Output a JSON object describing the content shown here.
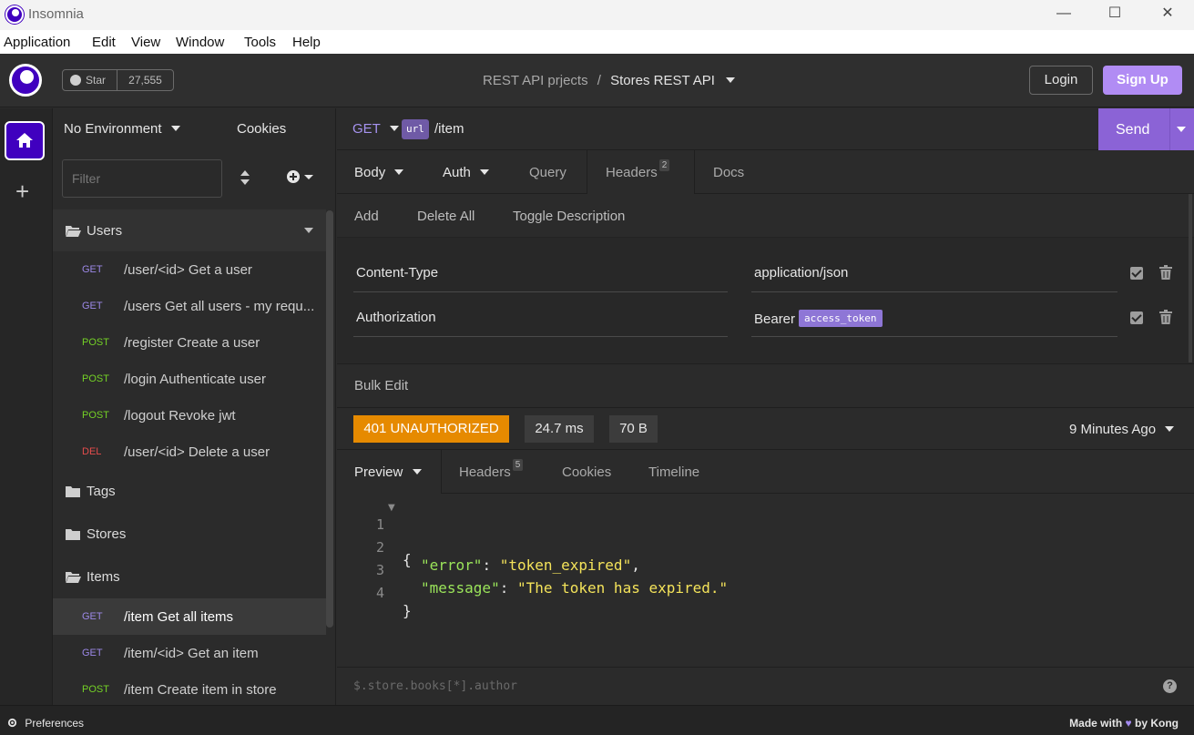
{
  "window": {
    "title": "Insomnia",
    "controls": {
      "minimize": "—",
      "maximize": "☐",
      "close": "✕"
    }
  },
  "menu": [
    "Application",
    "Edit",
    "View",
    "Window",
    "Tools",
    "Help"
  ],
  "header": {
    "github_star": "Star",
    "star_count": "27,555",
    "project": "REST API prjects",
    "separator": "/",
    "collection": "Stores REST API",
    "login": "Login",
    "signup": "Sign Up"
  },
  "sidebar": {
    "environment": "No Environment",
    "cookies": "Cookies",
    "filter_placeholder": "Filter",
    "folders": [
      {
        "name": "Users",
        "open": true,
        "requests": [
          {
            "method": "GET",
            "label": "/user/<id> Get a user"
          },
          {
            "method": "GET",
            "label": "/users Get all users - my requ..."
          },
          {
            "method": "POST",
            "label": "/register Create a user"
          },
          {
            "method": "POST",
            "label": "/login Authenticate user"
          },
          {
            "method": "POST",
            "label": "/logout Revoke jwt"
          },
          {
            "method": "DEL",
            "label": "/user/<id> Delete a user"
          }
        ]
      },
      {
        "name": "Tags",
        "open": false
      },
      {
        "name": "Stores",
        "open": false
      },
      {
        "name": "Items",
        "open": true,
        "requests": [
          {
            "method": "GET",
            "label": "/item Get all items",
            "active": true
          },
          {
            "method": "GET",
            "label": "/item/<id> Get an item"
          },
          {
            "method": "POST",
            "label": "/item Create item in store"
          }
        ]
      }
    ]
  },
  "request": {
    "method": "GET",
    "url_tag": "url",
    "path": "/item",
    "send": "Send",
    "tabs": {
      "body": "Body",
      "auth": "Auth",
      "query": "Query",
      "headers": "Headers",
      "headers_count": "2",
      "docs": "Docs"
    },
    "header_actions": {
      "add": "Add",
      "delete_all": "Delete All",
      "toggle_description": "Toggle Description"
    },
    "headers": [
      {
        "name": "Content-Type",
        "value": "application/json"
      },
      {
        "name": "Authorization",
        "value": "Bearer",
        "token": "access_token"
      }
    ],
    "bulk_edit": "Bulk Edit"
  },
  "response": {
    "status": "401 UNAUTHORIZED",
    "time": "24.7 ms",
    "size": "70 B",
    "ago": "9 Minutes Ago",
    "tabs": {
      "preview": "Preview",
      "headers": "Headers",
      "headers_count": "5",
      "cookies": "Cookies",
      "timeline": "Timeline"
    },
    "body_lines": [
      {
        "n": "1",
        "open": "{"
      },
      {
        "n": "2",
        "key": "\"error\"",
        "colon": ": ",
        "value": "\"token_expired\"",
        "tail": ","
      },
      {
        "n": "3",
        "key": "\"message\"",
        "colon": ": ",
        "value": "\"The token has expired.\"",
        "tail": ""
      },
      {
        "n": "4",
        "close": "}"
      }
    ],
    "jsonpath_placeholder": "$.store.books[*].author",
    "help": "?"
  },
  "footer": {
    "preferences": "Preferences",
    "made_with": "Made with",
    "by": "by Kong"
  },
  "colors": {
    "accent": "#4000bf",
    "send": "#8b63d6",
    "signup": "#b18cf4",
    "status_401": "#e68a00",
    "get": "#9c88e7",
    "post": "#74d126",
    "del": "#e44c4c"
  }
}
